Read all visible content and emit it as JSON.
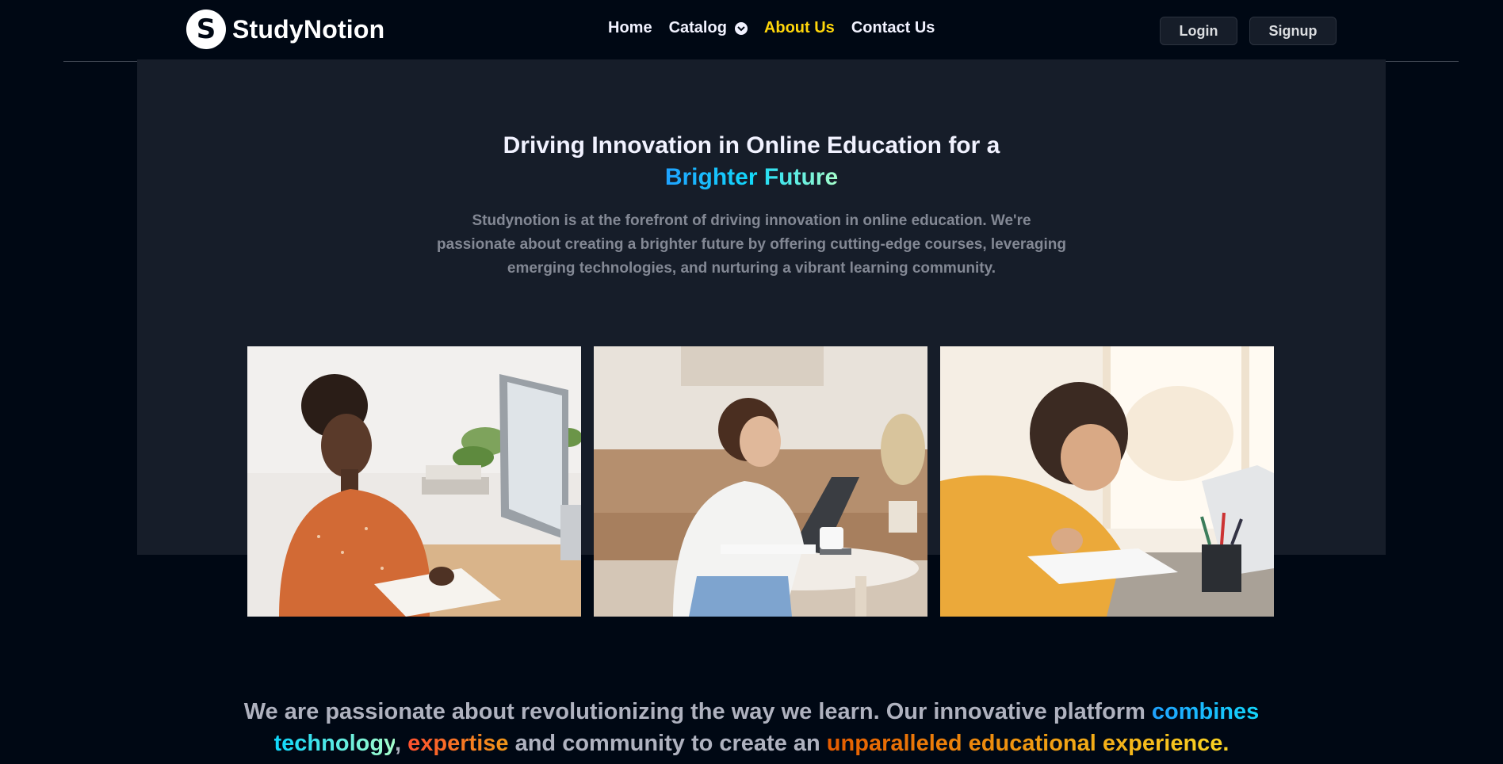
{
  "brand": {
    "logo_letter": "S",
    "name": "StudyNotion"
  },
  "nav": {
    "items": [
      {
        "label": "Home"
      },
      {
        "label": "Catalog"
      },
      {
        "label": "About Us"
      },
      {
        "label": "Contact Us"
      }
    ],
    "active": "About Us",
    "login_label": "Login",
    "signup_label": "Signup"
  },
  "hero": {
    "title_plain": "Driving Innovation in Online Education for a",
    "title_highlight": "Brighter Future",
    "description": "Studynotion is at the forefront of driving innovation in online education. We're passionate about creating a brighter future by offering cutting-edge courses, leveraging emerging technologies, and nurturing a vibrant learning community.",
    "images": [
      {
        "icon": "woman-at-desktop-computer-photo"
      },
      {
        "icon": "woman-writing-at-laptop-photo"
      },
      {
        "icon": "woman-writing-in-notebook-photo"
      }
    ]
  },
  "quote": {
    "part1": "We are passionate about revolutionizing the way we learn. Our innovative platform ",
    "highlight1": "combines technology",
    "comma": ",",
    "highlight2": "expertise",
    "part2": " and community to create an ",
    "highlight3": "unparalleled educational experience."
  },
  "colors": {
    "background": "#000814",
    "surface": "#161d29",
    "active_nav": "#ffd60a",
    "muted_text": "#838894"
  }
}
